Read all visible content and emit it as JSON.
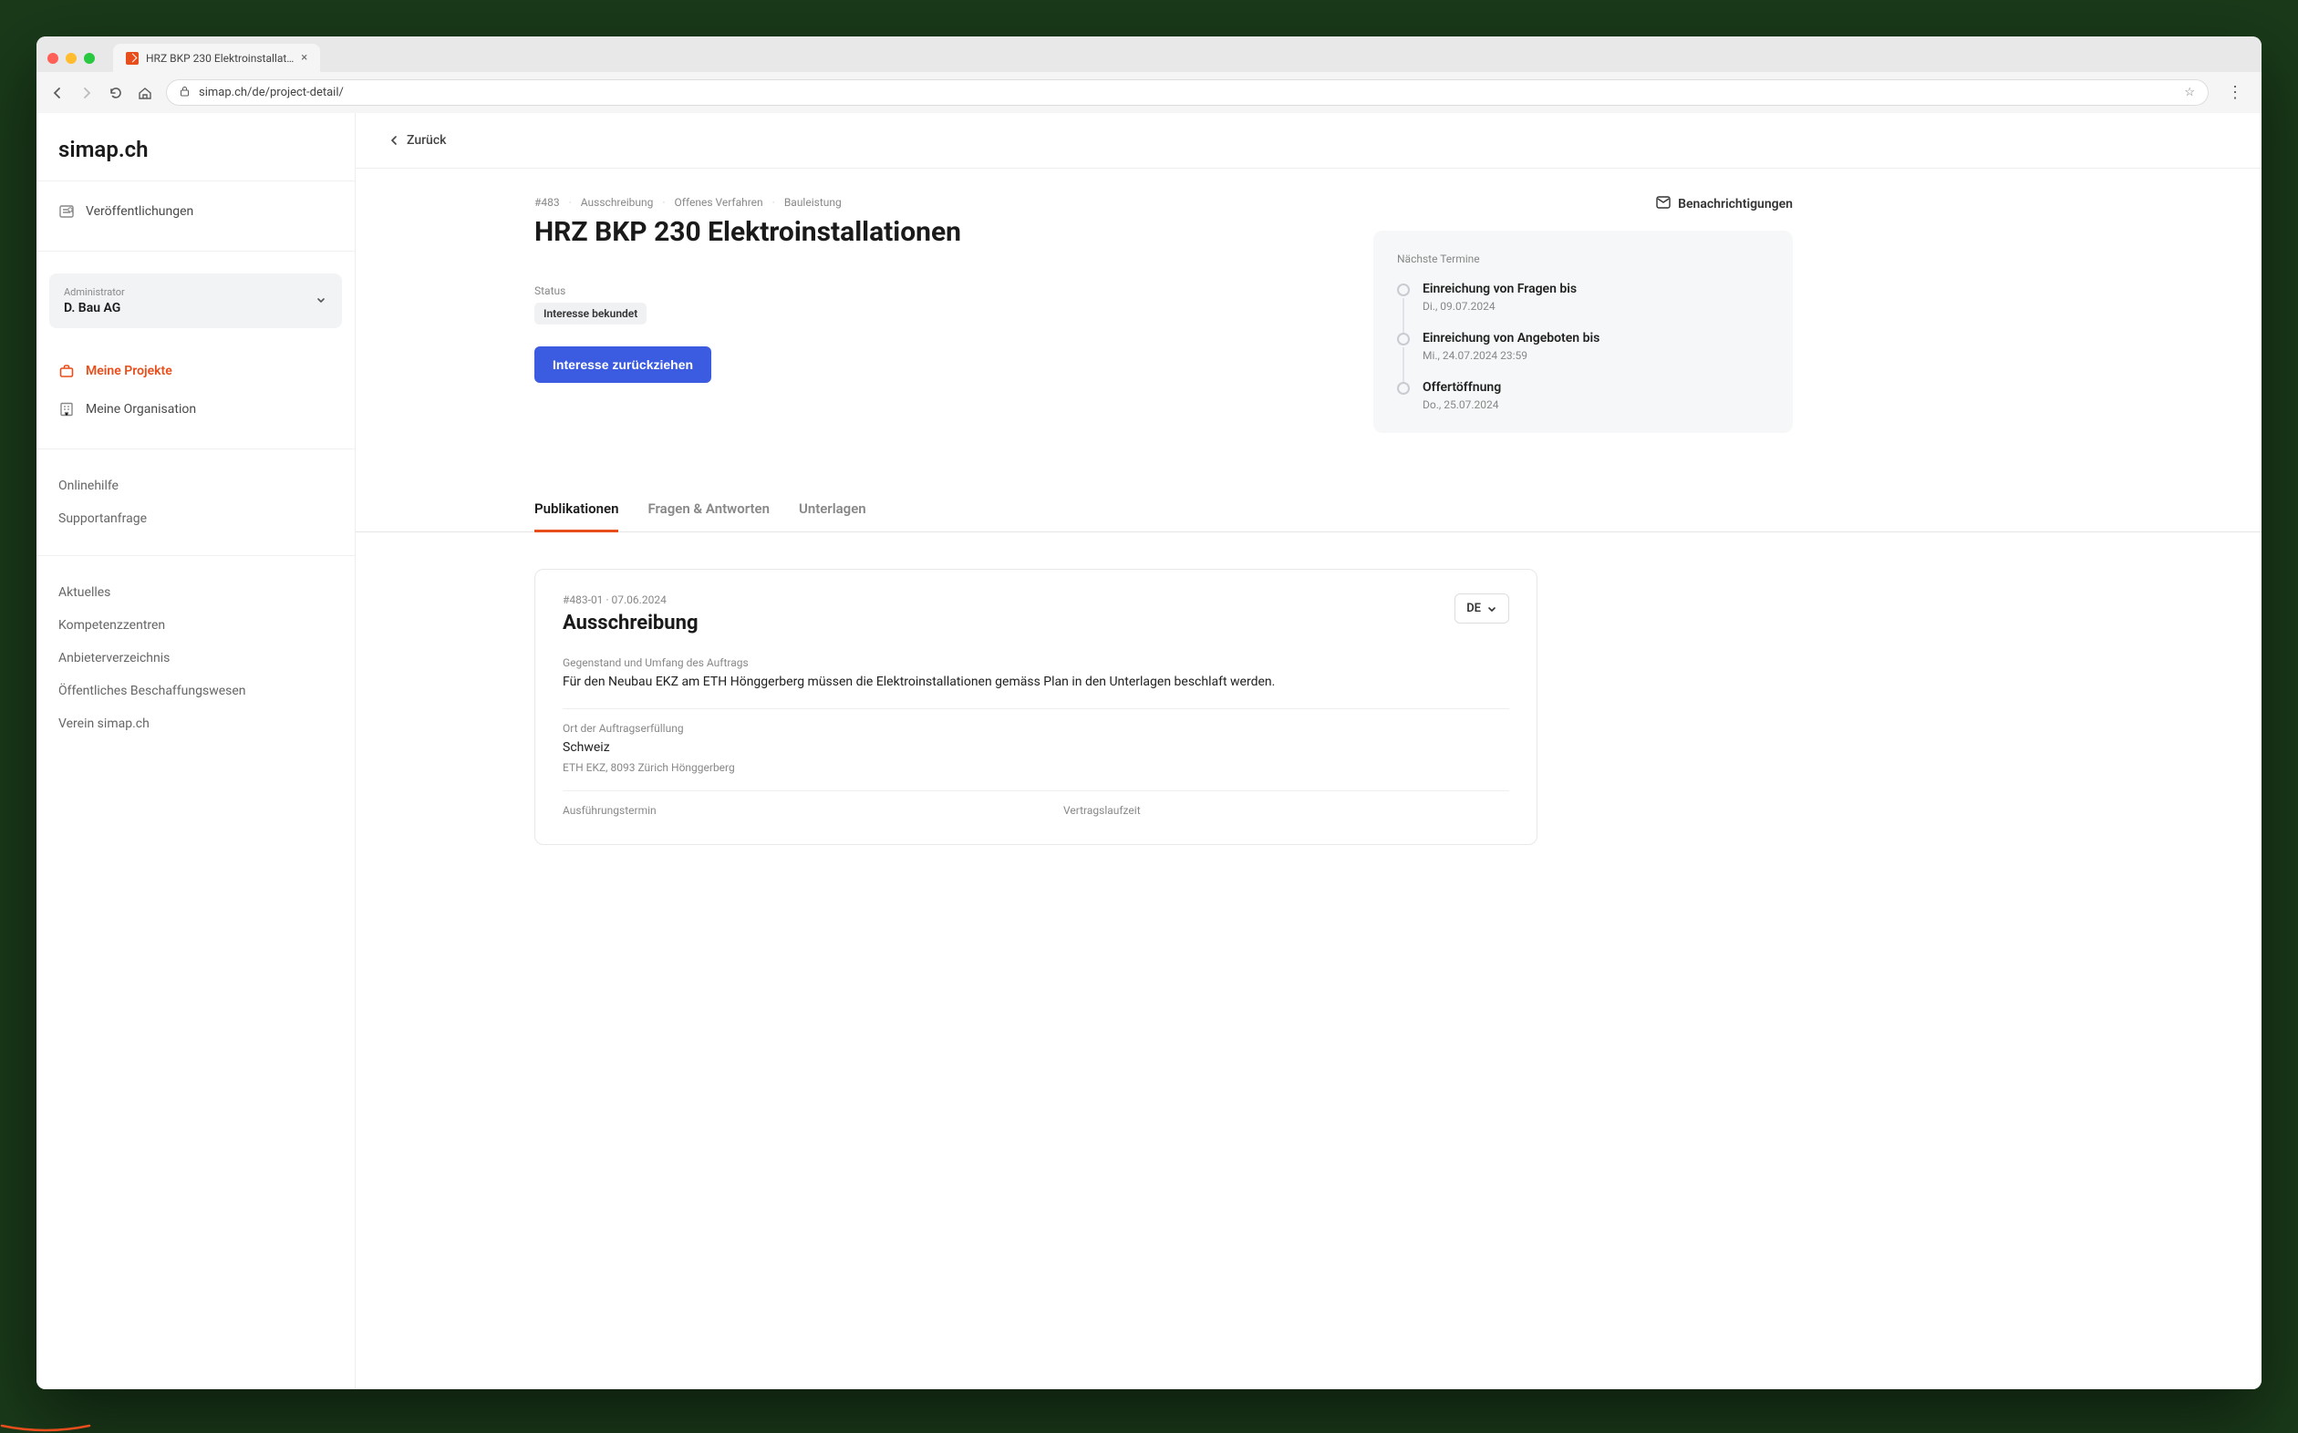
{
  "browser": {
    "tab_title": "HRZ BKP 230 Elektroinstallat…",
    "url": "simap.ch/de/project-detail/"
  },
  "logo": "simap.ch",
  "sidebar": {
    "publications": "Veröffentlichungen",
    "role": "Administrator",
    "org": "D. Bau AG",
    "my_projects": "Meine Projekte",
    "my_org": "Meine Organisation",
    "online_help": "Onlinehilfe",
    "support": "Supportanfrage",
    "news": "Aktuelles",
    "competence": "Kompetenzzentren",
    "providers": "Anbieterverzeichnis",
    "procurement": "Öffentliches Beschaffungswesen",
    "assoc": "Verein simap.ch"
  },
  "back": "Zurück",
  "breadcrumbs": [
    "#483",
    "Ausschreibung",
    "Offenes Verfahren",
    "Bauleistung"
  ],
  "title": "HRZ BKP 230 Elektroinstallationen",
  "status_label": "Status",
  "status_value": "Interesse bekundet",
  "withdraw_btn": "Interesse zurückziehen",
  "notifications": "Benachrichtigungen",
  "timeline": {
    "title": "Nächste Termine",
    "items": [
      {
        "label": "Einreichung von Fragen bis",
        "date": "Di., 09.07.2024"
      },
      {
        "label": "Einreichung von Angeboten bis",
        "date": "Mi., 24.07.2024 23:59"
      },
      {
        "label": "Offertöffnung",
        "date": "Do., 25.07.2024"
      }
    ]
  },
  "tabs": [
    "Publikationen",
    "Fragen & Antworten",
    "Unterlagen"
  ],
  "detail": {
    "meta_id": "#483-01",
    "meta_date": "07.06.2024",
    "title": "Ausschreibung",
    "lang": "DE",
    "subject_label": "Gegenstand und Umfang des Auftrags",
    "subject_value": "Für den Neubau EKZ am ETH Hönggerberg müssen die Elektroinstallationen gemäss Plan in den Unterlagen beschlaft werden.",
    "place_label": "Ort der Auftragserfüllung",
    "place_value": "Schweiz",
    "place_sub": "ETH EKZ, 8093 Zürich Hönggerberg",
    "exec_label": "Ausführungstermin",
    "contract_label": "Vertragslaufzeit"
  }
}
